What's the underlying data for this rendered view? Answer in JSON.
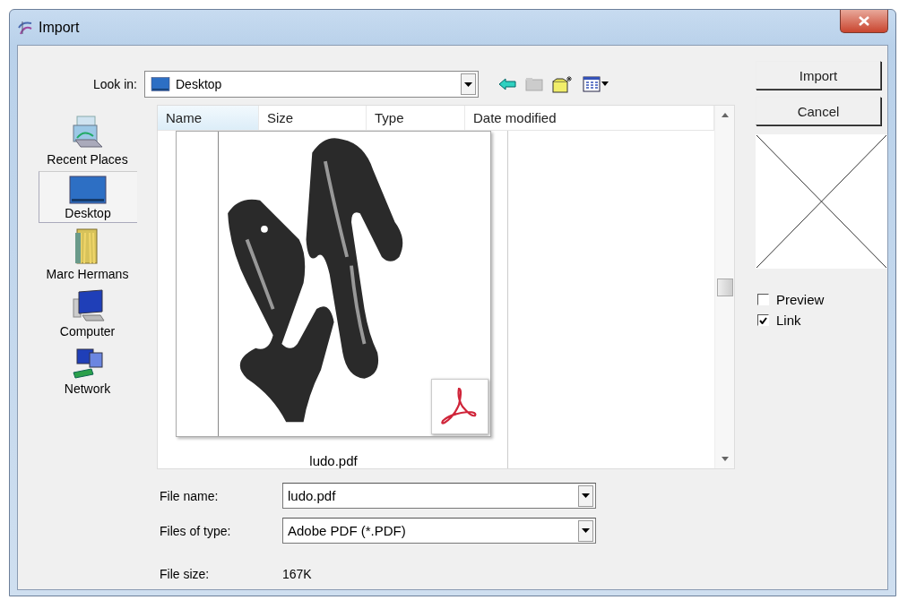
{
  "window": {
    "title": "Import"
  },
  "look_in": {
    "label": "Look in:",
    "value": "Desktop"
  },
  "places": [
    {
      "label": "Recent Places",
      "selected": false
    },
    {
      "label": "Desktop",
      "selected": true
    },
    {
      "label": "Marc Hermans",
      "selected": false
    },
    {
      "label": "Computer",
      "selected": false
    },
    {
      "label": "Network",
      "selected": false
    }
  ],
  "file_list": {
    "columns": [
      "Name",
      "Size",
      "Type",
      "Date modified"
    ],
    "items": [
      {
        "name": "ludo.pdf"
      }
    ]
  },
  "buttons": [
    "Import",
    "Cancel"
  ],
  "options": [
    {
      "label": "Preview",
      "checked": false
    },
    {
      "label": "Link",
      "checked": true
    }
  ],
  "file_name": {
    "label": "File name:",
    "value": "ludo.pdf"
  },
  "file_type": {
    "label": "Files of type:",
    "value": "Adobe PDF (*.PDF)"
  },
  "file_size": {
    "label": "File size:",
    "value": "167K"
  }
}
